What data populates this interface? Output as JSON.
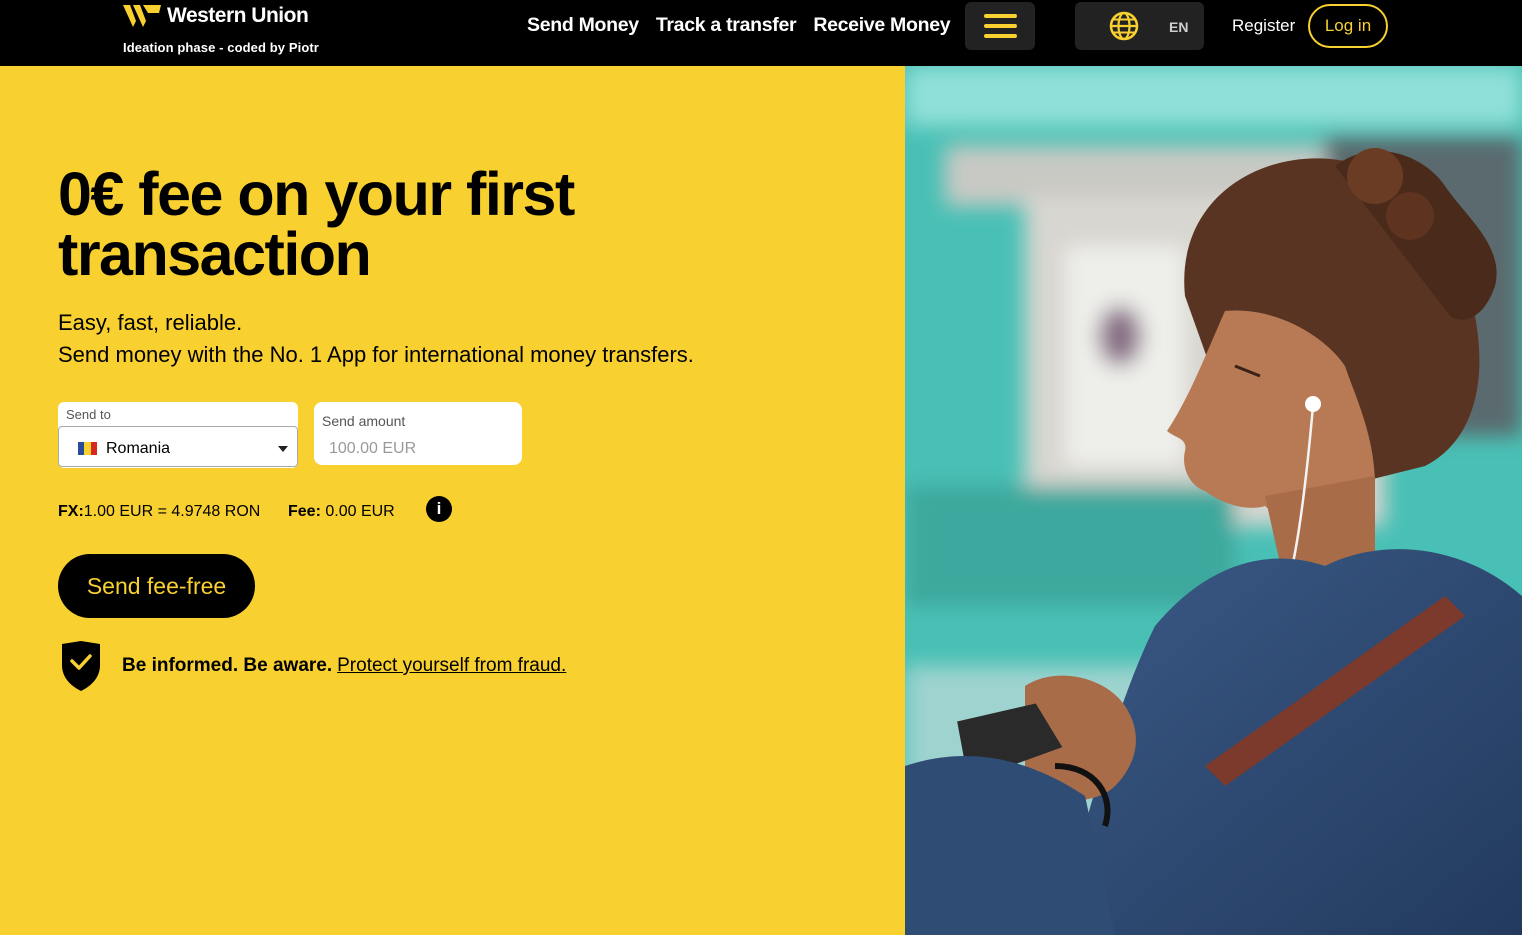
{
  "header": {
    "brand_name": "Western Union",
    "brand_subtitle": "Ideation phase - coded by Piotr",
    "nav": [
      "Send Money",
      "Track a transfer",
      "Receive Money"
    ],
    "menu_icon": "hamburger-icon",
    "language_icon": "globe-icon",
    "language": "EN",
    "register": "Register",
    "login": "Log in"
  },
  "hero": {
    "headline": "0€ fee on your first transaction",
    "subtitle_1": "Easy, fast, reliable.",
    "subtitle_2": "Send money with the No. 1 App for international money transfers.",
    "send_to": {
      "label": "Send to",
      "value": "Romania",
      "flag_icon": "romania-flag-icon"
    },
    "send_amount": {
      "label": "Send amount",
      "value": "",
      "placeholder": "100.00 EUR"
    },
    "fx": {
      "label": "FX:",
      "value": "1.00 EUR = 4.9748 RON"
    },
    "fee": {
      "label": "Fee:",
      "value": "0.00 EUR"
    },
    "info_icon": "info-icon",
    "cta": "Send fee-free",
    "fraud": {
      "icon": "shield-check-icon",
      "text": "Be informed. Be aware.",
      "link": "Protect yourself from fraud."
    }
  },
  "colors": {
    "brand_yellow": "#f8d030",
    "header_bg": "#000000",
    "button_bg": "#000000"
  }
}
